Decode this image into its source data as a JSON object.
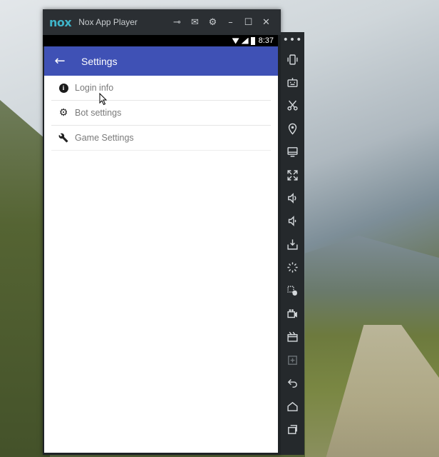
{
  "window": {
    "logo": "nox",
    "title": "Nox App Player",
    "controls": [
      "pin-icon",
      "mail-icon",
      "gear-icon",
      "minimize-icon",
      "maximize-icon",
      "close-icon"
    ],
    "control_glyphs": [
      "⊸",
      "✉",
      "⚙",
      "–",
      "☐",
      "✕"
    ]
  },
  "status_bar": {
    "time": "8:37"
  },
  "app": {
    "title": "Settings",
    "back_glyph": "←",
    "accent": "#3f51b5",
    "items": [
      {
        "label": "Login info",
        "icon": "info-icon"
      },
      {
        "label": "Bot settings",
        "icon": "gear-icon"
      },
      {
        "label": "Game Settings",
        "icon": "wrench-icon"
      }
    ]
  },
  "toolbar": {
    "more_glyph": "•••",
    "buttons": [
      "shake-icon",
      "keyboard-mapping-icon",
      "screenshot-scissors-icon",
      "location-icon",
      "display-icon",
      "fullscreen-icon",
      "volume-up-icon",
      "volume-down-icon",
      "install-apk-icon",
      "loading-icon",
      "macro-icon",
      "record-icon",
      "multi-instance-icon",
      "add-icon",
      "back-icon",
      "home-icon",
      "recent-apps-icon"
    ]
  }
}
